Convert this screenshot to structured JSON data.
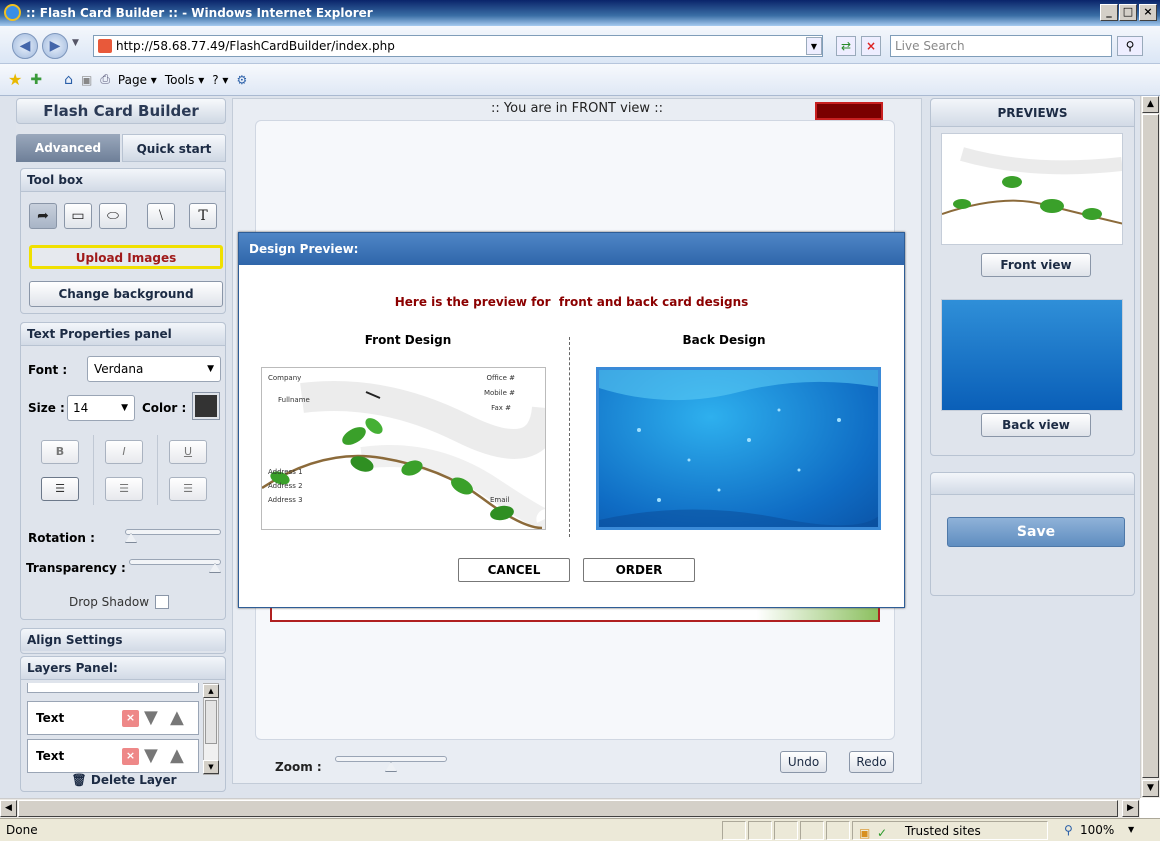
{
  "window": {
    "title": ":: Flash Card Builder :: - Windows Internet Explorer",
    "min": "_",
    "max": "□",
    "close": "×"
  },
  "browser": {
    "url": "http://58.68.77.49/FlashCardBuilder/index.php",
    "search_placeholder": "Live Search",
    "commands": [
      "Page ▾",
      "Tools ▾",
      "? ▾"
    ],
    "status": "Done",
    "zone": "Trusted sites",
    "zoom": "100%"
  },
  "left": {
    "app_title": "Flash Card Builder",
    "tabs": [
      "Advanced",
      "Quick start"
    ],
    "toolbox_title": "Tool box",
    "upload_label": "Upload Images",
    "background_label": "Change background",
    "text_panel_title": "Text Properties panel",
    "font_label": "Font :",
    "font_value": "Verdana",
    "size_label": "Size :",
    "size_value": "14",
    "color_label": "Color :",
    "text_color": "#333333",
    "format_buttons": [
      "B",
      "I",
      "U"
    ],
    "rotation_label": "Rotation :",
    "rotation_level": 0,
    "transparency_label": "Transparency :",
    "transparency_level": 1,
    "drop_shadow_label": "Drop Shadow",
    "align_title": "Align Settings",
    "layers_title": "Layers Panel:",
    "layers": [
      "Text",
      "Text"
    ],
    "delete_label": "Delete Layer"
  },
  "center": {
    "view_label": ":: You are in FRONT view ::",
    "zoom_label": "Zoom :",
    "zoom_level": 0.5,
    "undo_label": "Undo",
    "redo_label": "Redo"
  },
  "right": {
    "previews_title": "PREVIEWS",
    "front_view_label": "Front view",
    "back_view_label": "Back view",
    "save_label": "Save"
  },
  "modal": {
    "title": "Design Preview:",
    "message": "Here is the preview for  front and back card designs",
    "front_label": "Front Design",
    "back_label": "Back Design",
    "cancel_label": "CANCEL",
    "order_label": "ORDER",
    "front_card": {
      "company": "Company",
      "fullname": "Fullname",
      "office": "Office #",
      "mobile": "Mobile #",
      "fax": "Fax #",
      "address1": "Address 1",
      "address2": "Address 2",
      "address3": "Address 3",
      "email": "Email"
    }
  },
  "colors": {
    "accent_red": "#8b0000",
    "highlight": "#f0e000",
    "modal_header": "#3a70b4",
    "save_button": "#5f8dc0"
  }
}
